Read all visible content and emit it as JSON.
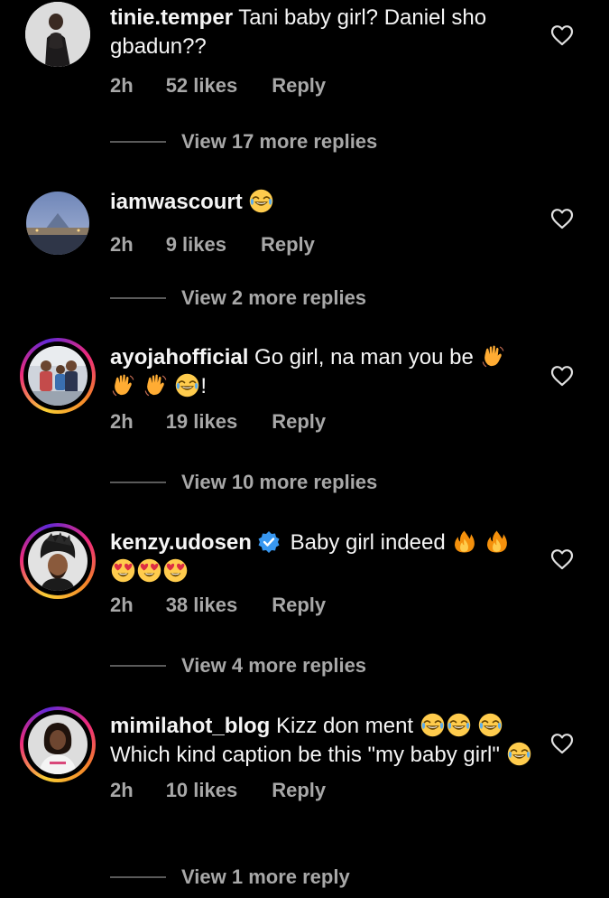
{
  "colors": {
    "background": "#000000",
    "text": "#f5f5f5",
    "muted": "#a8a8a8",
    "verified": "#3897f0"
  },
  "comments": [
    {
      "username": "tinie.temper",
      "text": "Tani baby girl? Daniel sho gbadun??",
      "time": "2h",
      "likes": "52 likes",
      "reply": "Reply",
      "view_replies": "View 17 more replies",
      "avatar": "avatar-woman-dark-dress"
    },
    {
      "username": "iamwascourt",
      "text": "",
      "emojis_after": [
        "face-with-tears-of-joy"
      ],
      "time": "2h",
      "likes": "9 likes",
      "reply": "Reply",
      "view_replies": "View 2 more replies",
      "avatar": "avatar-louvre-pyramid"
    },
    {
      "username": "ayojahofficial",
      "text": "Go girl, na man you be",
      "emojis_after": [
        "waving-hand",
        "waving-hand",
        "waving-hand",
        "face-with-tears-of-joy"
      ],
      "trailing": "!",
      "time": "2h",
      "likes": "19 likes",
      "reply": "Reply",
      "view_replies": "View 10 more replies",
      "avatar": "avatar-family-photo"
    },
    {
      "username": "kenzy.udosen",
      "verified": true,
      "text": "Baby girl indeed",
      "emojis_after": [
        "fire",
        "fire",
        "heart-eyes",
        "heart-eyes",
        "heart-eyes"
      ],
      "time": "2h",
      "likes": "38 likes",
      "reply": "Reply",
      "view_replies": "View 4 more replies",
      "avatar": "avatar-man-headwrap"
    },
    {
      "username": "mimilahot_blog",
      "text_part1": "Kizz don ment",
      "text_part2": "Which kind caption be this \"my baby girl\"",
      "time": "2h",
      "likes": "10 likes",
      "reply": "Reply",
      "view_replies": "View 1 more reply",
      "avatar": "avatar-woman-white-top"
    }
  ]
}
